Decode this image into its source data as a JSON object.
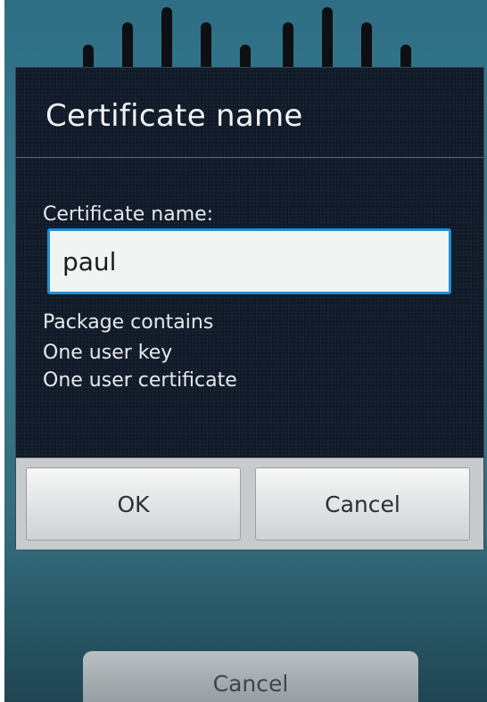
{
  "dialog": {
    "title": "Certificate name",
    "field_label": "Certificate name:",
    "input_value": "paul",
    "package_heading": "Package contains",
    "package_items": [
      "One user key",
      "One user certificate"
    ],
    "ok_label": "OK",
    "cancel_label": "Cancel"
  },
  "background": {
    "cancel_label": "Cancel"
  },
  "colors": {
    "dialog_background": "#101a28",
    "input_focus_border": "#1f8fd0",
    "screen_background": "#3a7c90"
  }
}
